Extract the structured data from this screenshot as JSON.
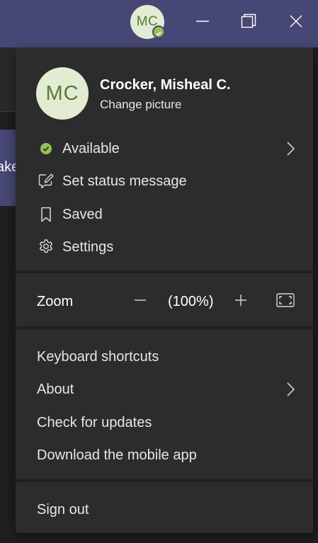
{
  "titlebar": {
    "avatar_initials": "MC",
    "presence": "available",
    "buttons": [
      "minimize-icon",
      "restore-icon",
      "close-icon"
    ]
  },
  "background": {
    "partial_text": "ake"
  },
  "profile": {
    "initials": "MC",
    "name": "Crocker, Misheal C.",
    "change_picture": "Change picture"
  },
  "status_items": [
    {
      "label": "Available",
      "icon": "presence-available-icon",
      "has_submenu": true
    },
    {
      "label": "Set status message",
      "icon": "edit-status-icon"
    },
    {
      "label": "Saved",
      "icon": "bookmark-icon"
    },
    {
      "label": "Settings",
      "icon": "gear-icon"
    }
  ],
  "zoom": {
    "label": "Zoom",
    "value": "(100%)"
  },
  "help_items": [
    {
      "label": "Keyboard shortcuts"
    },
    {
      "label": "About",
      "has_submenu": true
    },
    {
      "label": "Check for updates"
    },
    {
      "label": "Download the mobile app"
    }
  ],
  "sign_out": "Sign out",
  "colors": {
    "titlebar": "#464775",
    "menu_bg": "#2d2c2c",
    "avatar_bg": "#e2ecd2",
    "avatar_text": "#5a7a35",
    "presence_green": "#92c353"
  }
}
